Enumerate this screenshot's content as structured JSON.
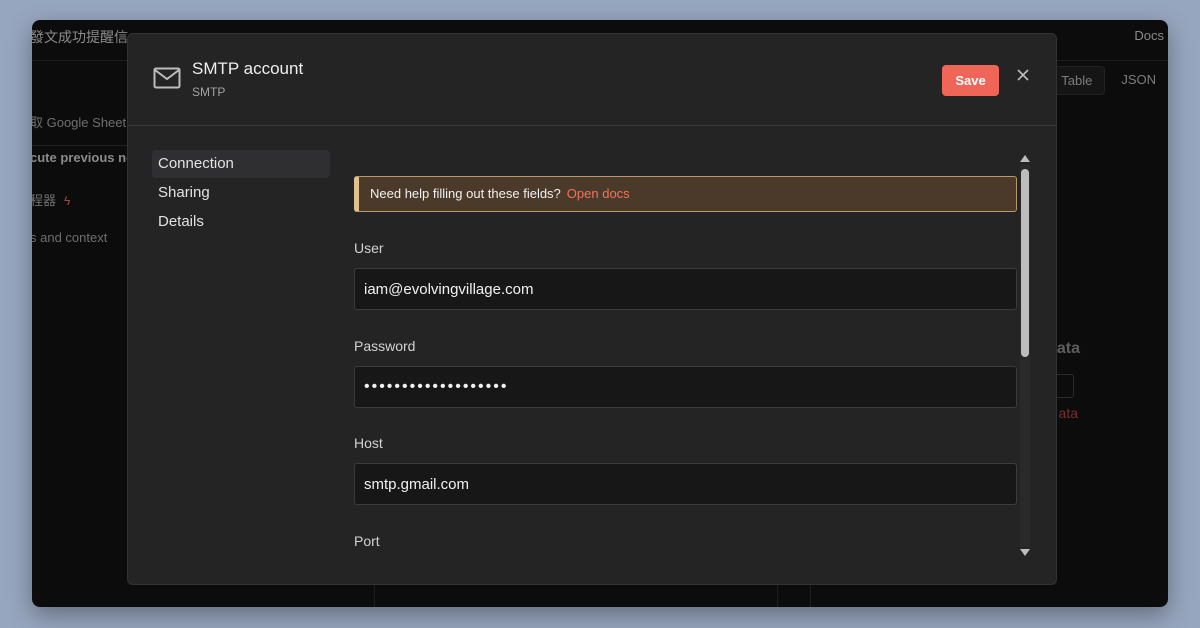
{
  "background_app": {
    "title": "發文成功提醒信",
    "docs_link": "Docs",
    "left_items": [
      "取 Google Sheet",
      "cute previous no",
      "程器",
      "s and context"
    ],
    "tabs": [
      "Table",
      "JSON"
    ],
    "right_title": "ata",
    "right_link": "ata"
  },
  "modal": {
    "title": "SMTP account",
    "subtitle": "SMTP",
    "save_label": "Save",
    "icon": "mail-icon",
    "close_icon": "close-icon",
    "nav": [
      {
        "label": "Connection",
        "active": true
      },
      {
        "label": "Sharing",
        "active": false
      },
      {
        "label": "Details",
        "active": false
      }
    ],
    "notice": {
      "text": "Need help filling out these fields?",
      "link": "Open docs"
    },
    "fields": {
      "user": {
        "label": "User",
        "value": "iam@evolvingvillage.com"
      },
      "password": {
        "label": "Password",
        "value": "•••••••••••••••••••"
      },
      "host": {
        "label": "Host",
        "value": "smtp.gmail.com"
      },
      "port": {
        "label": "Port"
      }
    }
  },
  "colors": {
    "accent": "#ef6557",
    "notice_bg": "#4b3a29",
    "notice_border": "#e0c08e",
    "modal_bg": "#242425"
  }
}
